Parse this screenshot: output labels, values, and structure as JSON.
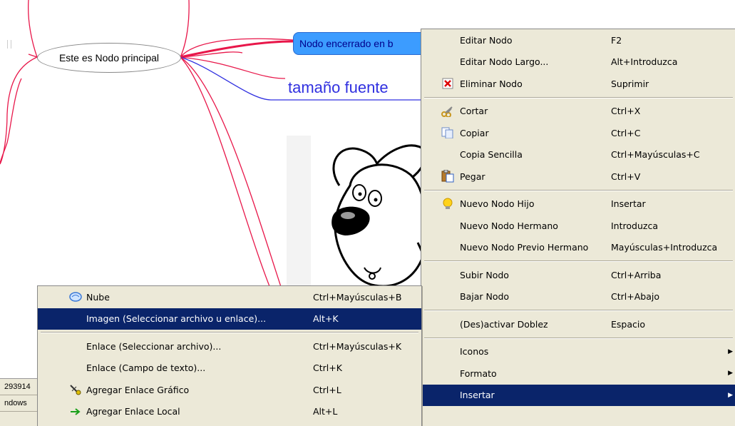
{
  "mindmap": {
    "main_node": "Este es Nodo principal",
    "cloud_node": "Nodo encerrado en b",
    "big_font_node": "tamaño fuente",
    "image_subject": "cartoon dog"
  },
  "statusbar": {
    "line1": "293914",
    "line2": "ndows"
  },
  "colors": {
    "edge": "#e8174a",
    "edge_blue": "#3030e0",
    "cloud_fill": "#3c9cff",
    "menu_bg": "#ece9d8",
    "selected": "#0a246a"
  },
  "context_menu": {
    "items": [
      {
        "label": "Editar Nodo",
        "shortcut": "F2",
        "icon": ""
      },
      {
        "label": "Editar Nodo Largo...",
        "shortcut": "Alt+Introduzca",
        "icon": ""
      },
      {
        "label": "Eliminar Nodo",
        "shortcut": "Suprimir",
        "icon": "delete-icon"
      },
      {
        "label": "Cortar",
        "shortcut": "Ctrl+X",
        "icon": "scissors-icon"
      },
      {
        "label": "Copiar",
        "shortcut": "Ctrl+C",
        "icon": "copy-icon"
      },
      {
        "label": "Copia Sencilla",
        "shortcut": "Ctrl+Mayúsculas+C",
        "icon": ""
      },
      {
        "label": "Pegar",
        "shortcut": "Ctrl+V",
        "icon": "paste-icon"
      },
      {
        "label": "Nuevo Nodo Hijo",
        "shortcut": "Insertar",
        "icon": "lightbulb-icon"
      },
      {
        "label": "Nuevo Nodo Hermano",
        "shortcut": "Introduzca",
        "icon": ""
      },
      {
        "label": "Nuevo Nodo Previo Hermano",
        "shortcut": "Mayúsculas+Introduzca",
        "icon": ""
      },
      {
        "label": "Subir Nodo",
        "shortcut": "Ctrl+Arriba",
        "icon": ""
      },
      {
        "label": "Bajar Nodo",
        "shortcut": "Ctrl+Abajo",
        "icon": ""
      },
      {
        "label": "(Des)activar Doblez",
        "shortcut": "Espacio",
        "icon": ""
      },
      {
        "label": "Iconos",
        "shortcut": "",
        "icon": ""
      },
      {
        "label": "Formato",
        "shortcut": "",
        "icon": ""
      },
      {
        "label": "Insertar",
        "shortcut": "",
        "icon": ""
      }
    ]
  },
  "submenu": {
    "items": [
      {
        "label": "Nube",
        "shortcut": "Ctrl+Mayúsculas+B",
        "icon": "cloud-icon"
      },
      {
        "label": "Imagen (Seleccionar archivo u enlace)...",
        "shortcut": "Alt+K",
        "icon": ""
      },
      {
        "label": "Enlace (Seleccionar archivo)...",
        "shortcut": "Ctrl+Mayúsculas+K",
        "icon": ""
      },
      {
        "label": "Enlace (Campo de texto)...",
        "shortcut": "Ctrl+K",
        "icon": ""
      },
      {
        "label": "Agregar Enlace Gráfico",
        "shortcut": "Ctrl+L",
        "icon": "graphic-link-icon"
      },
      {
        "label": "Agregar Enlace Local",
        "shortcut": "Alt+L",
        "icon": "arrow-right-icon"
      }
    ]
  }
}
